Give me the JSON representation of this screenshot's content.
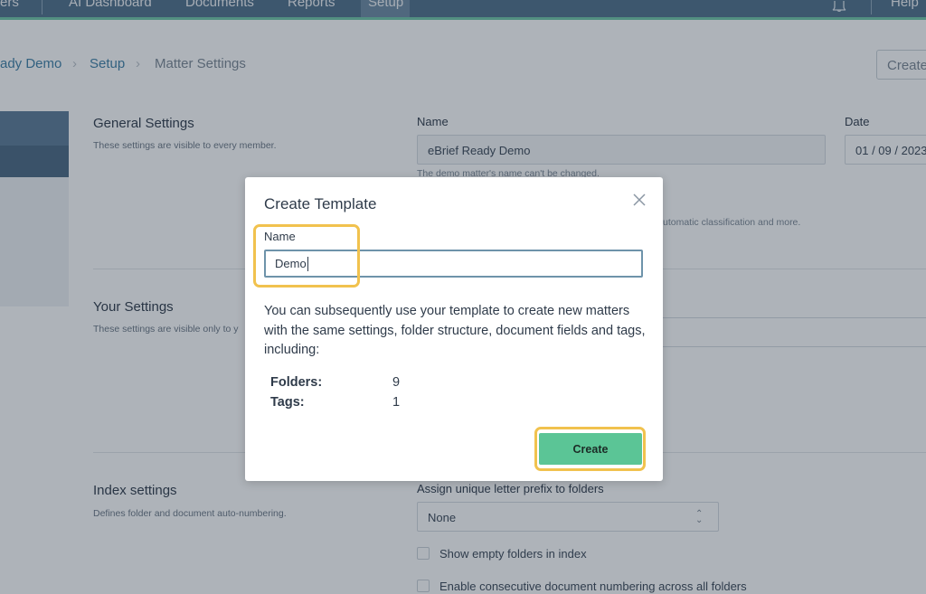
{
  "nav": {
    "items": [
      "ers",
      "AI Dashboard",
      "Documents",
      "Reports",
      "Setup"
    ],
    "help": "Help"
  },
  "breadcrumb": [
    "ady Demo",
    "Setup",
    "Matter Settings"
  ],
  "top_create_label": "Create",
  "general": {
    "title": "General Settings",
    "desc": "These settings are visible to every member.",
    "name_label": "Name",
    "name_value": "eBrief Ready Demo",
    "name_hint": "The demo matter's name can't be changed.",
    "date_label": "Date",
    "date_value": "01 / 09 / 2023",
    "partial_hint": "utomatic classification and more."
  },
  "your_settings": {
    "title": "Your Settings",
    "desc": "These settings are visible only to y"
  },
  "index": {
    "title": "Index settings",
    "desc": "Defines folder and document auto-numbering.",
    "prefix_label": "Assign unique letter prefix to folders",
    "prefix_value": "None",
    "chk1": "Show empty folders in index",
    "chk2": "Enable consecutive document numbering across all folders"
  },
  "modal": {
    "title": "Create Template",
    "name_label": "Name",
    "name_value": "Demo",
    "description": "You can subsequently use your template to create new matters with the same settings, folder structure, document fields and tags, including:",
    "stats": [
      {
        "label": "Folders:",
        "value": "9"
      },
      {
        "label": "Tags:",
        "value": "1"
      }
    ],
    "create_label": "Create"
  },
  "colors": {
    "nav_bg": "#4f6f8a",
    "accent_green": "#5bc596",
    "highlight": "#f1c24e",
    "link": "#3d7fa6"
  },
  "icons": [
    "bell-icon",
    "close-icon",
    "chevron-right-icon",
    "updown-icon"
  ]
}
